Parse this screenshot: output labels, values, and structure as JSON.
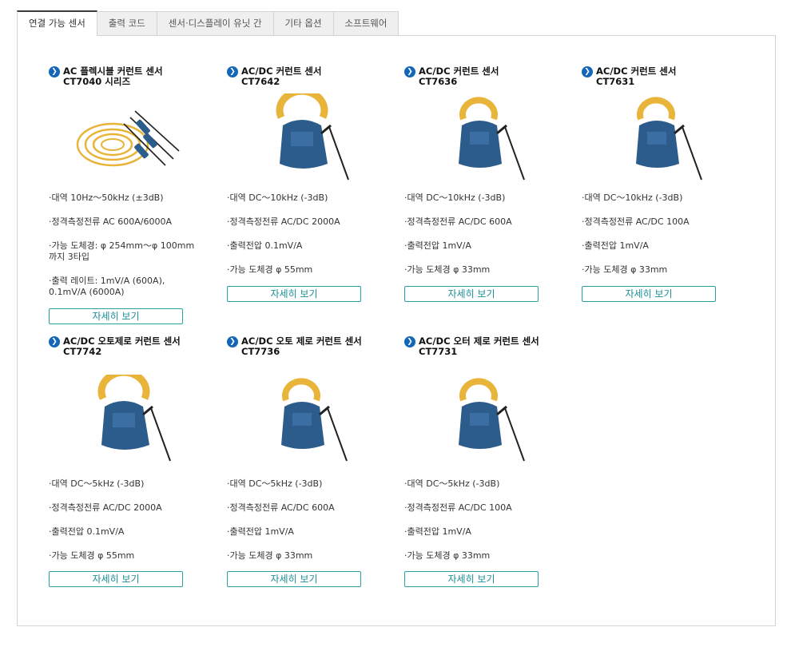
{
  "tabs": [
    "연결 가능 센서",
    "출력 코드",
    "센서·디스플레이 유닛 간",
    "기타 옵션",
    "소프트웨어"
  ],
  "detail_label": "자세히 보기",
  "cards": [
    {
      "title1": "AC 플렉시블 커런트 센서",
      "title2": "CT7040 시리즈",
      "specs": [
        "·대역 10Hz～50kHz (±3dB)",
        "·정격측정전류 AC 600A/6000A",
        "·가능 도체경: φ 254mm～φ 100mm 까지 3타입",
        "·출력 레이트: 1mV/A (600A), 0.1mV/A (6000A)"
      ]
    },
    {
      "title1": "AC/DC 커런트 센서",
      "title2": "CT7642",
      "specs": [
        "·대역 DC～10kHz (-3dB)",
        "·정격측정전류 AC/DC 2000A",
        "·출력전압 0.1mV/A",
        "·가능 도체경 φ 55mm"
      ]
    },
    {
      "title1": "AC/DC 커런트 센서",
      "title2": "CT7636",
      "specs": [
        "·대역 DC～10kHz (-3dB)",
        "·정격측정전류 AC/DC 600A",
        "·출력전압 1mV/A",
        "·가능 도체경 φ 33mm"
      ]
    },
    {
      "title1": "AC/DC 커런트 센서",
      "title2": "CT7631",
      "specs": [
        "·대역 DC～10kHz (-3dB)",
        "·정격측정전류 AC/DC 100A",
        "·출력전압 1mV/A",
        "·가능 도체경 φ 33mm"
      ]
    },
    {
      "title1": "AC/DC 오토제로 커런트 센서",
      "title2": "CT7742",
      "specs": [
        "·대역 DC～5kHz (-3dB)",
        "·정격측정전류 AC/DC 2000A",
        "·출력전압 0.1mV/A",
        "·가능 도체경 φ 55mm"
      ]
    },
    {
      "title1": "AC/DC 오토 제로 커런트 센서",
      "title2": "CT7736",
      "specs": [
        "·대역 DC～5kHz (-3dB)",
        "·정격측정전류 AC/DC 600A",
        "·출력전압 1mV/A",
        "·가능 도체경 φ 33mm"
      ]
    },
    {
      "title1": "AC/DC 오터 제로 커런트 센서",
      "title2": "CT7731",
      "specs": [
        "·대역 DC～5kHz (-3dB)",
        "·정격측정전류 AC/DC 100A",
        "·출력전압 1mV/A",
        "·가능 도체경 φ 33mm"
      ]
    }
  ],
  "icons": {
    "title_arrow": "circle-arrow-right-icon"
  },
  "colors": {
    "accent": "#1466b8",
    "button_border": "#2aa1a6",
    "button_text": "#1b8f95",
    "sensor_yellow": "#e8b43a",
    "sensor_blue": "#2c5c8c"
  }
}
